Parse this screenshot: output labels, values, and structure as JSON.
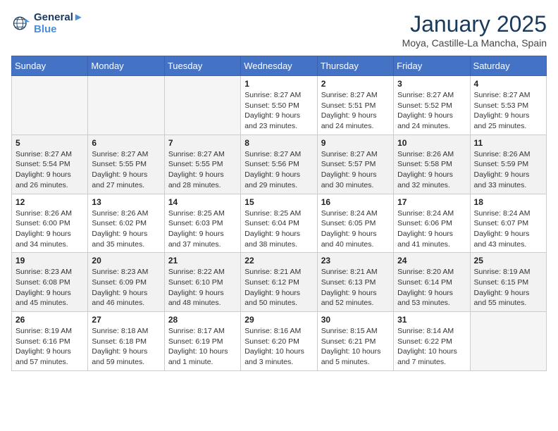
{
  "header": {
    "logo_line1": "General",
    "logo_line2": "Blue",
    "month": "January 2025",
    "location": "Moya, Castille-La Mancha, Spain"
  },
  "days_of_week": [
    "Sunday",
    "Monday",
    "Tuesday",
    "Wednesday",
    "Thursday",
    "Friday",
    "Saturday"
  ],
  "weeks": [
    [
      {
        "day": "",
        "empty": true
      },
      {
        "day": "",
        "empty": true
      },
      {
        "day": "",
        "empty": true
      },
      {
        "day": "1",
        "sunrise": "8:27 AM",
        "sunset": "5:50 PM",
        "daylight": "9 hours and 23 minutes."
      },
      {
        "day": "2",
        "sunrise": "8:27 AM",
        "sunset": "5:51 PM",
        "daylight": "9 hours and 24 minutes."
      },
      {
        "day": "3",
        "sunrise": "8:27 AM",
        "sunset": "5:52 PM",
        "daylight": "9 hours and 24 minutes."
      },
      {
        "day": "4",
        "sunrise": "8:27 AM",
        "sunset": "5:53 PM",
        "daylight": "9 hours and 25 minutes."
      }
    ],
    [
      {
        "day": "5",
        "sunrise": "8:27 AM",
        "sunset": "5:54 PM",
        "daylight": "9 hours and 26 minutes."
      },
      {
        "day": "6",
        "sunrise": "8:27 AM",
        "sunset": "5:55 PM",
        "daylight": "9 hours and 27 minutes."
      },
      {
        "day": "7",
        "sunrise": "8:27 AM",
        "sunset": "5:55 PM",
        "daylight": "9 hours and 28 minutes."
      },
      {
        "day": "8",
        "sunrise": "8:27 AM",
        "sunset": "5:56 PM",
        "daylight": "9 hours and 29 minutes."
      },
      {
        "day": "9",
        "sunrise": "8:27 AM",
        "sunset": "5:57 PM",
        "daylight": "9 hours and 30 minutes."
      },
      {
        "day": "10",
        "sunrise": "8:26 AM",
        "sunset": "5:58 PM",
        "daylight": "9 hours and 32 minutes."
      },
      {
        "day": "11",
        "sunrise": "8:26 AM",
        "sunset": "5:59 PM",
        "daylight": "9 hours and 33 minutes."
      }
    ],
    [
      {
        "day": "12",
        "sunrise": "8:26 AM",
        "sunset": "6:00 PM",
        "daylight": "9 hours and 34 minutes."
      },
      {
        "day": "13",
        "sunrise": "8:26 AM",
        "sunset": "6:02 PM",
        "daylight": "9 hours and 35 minutes."
      },
      {
        "day": "14",
        "sunrise": "8:25 AM",
        "sunset": "6:03 PM",
        "daylight": "9 hours and 37 minutes."
      },
      {
        "day": "15",
        "sunrise": "8:25 AM",
        "sunset": "6:04 PM",
        "daylight": "9 hours and 38 minutes."
      },
      {
        "day": "16",
        "sunrise": "8:24 AM",
        "sunset": "6:05 PM",
        "daylight": "9 hours and 40 minutes."
      },
      {
        "day": "17",
        "sunrise": "8:24 AM",
        "sunset": "6:06 PM",
        "daylight": "9 hours and 41 minutes."
      },
      {
        "day": "18",
        "sunrise": "8:24 AM",
        "sunset": "6:07 PM",
        "daylight": "9 hours and 43 minutes."
      }
    ],
    [
      {
        "day": "19",
        "sunrise": "8:23 AM",
        "sunset": "6:08 PM",
        "daylight": "9 hours and 45 minutes."
      },
      {
        "day": "20",
        "sunrise": "8:23 AM",
        "sunset": "6:09 PM",
        "daylight": "9 hours and 46 minutes."
      },
      {
        "day": "21",
        "sunrise": "8:22 AM",
        "sunset": "6:10 PM",
        "daylight": "9 hours and 48 minutes."
      },
      {
        "day": "22",
        "sunrise": "8:21 AM",
        "sunset": "6:12 PM",
        "daylight": "9 hours and 50 minutes."
      },
      {
        "day": "23",
        "sunrise": "8:21 AM",
        "sunset": "6:13 PM",
        "daylight": "9 hours and 52 minutes."
      },
      {
        "day": "24",
        "sunrise": "8:20 AM",
        "sunset": "6:14 PM",
        "daylight": "9 hours and 53 minutes."
      },
      {
        "day": "25",
        "sunrise": "8:19 AM",
        "sunset": "6:15 PM",
        "daylight": "9 hours and 55 minutes."
      }
    ],
    [
      {
        "day": "26",
        "sunrise": "8:19 AM",
        "sunset": "6:16 PM",
        "daylight": "9 hours and 57 minutes."
      },
      {
        "day": "27",
        "sunrise": "8:18 AM",
        "sunset": "6:18 PM",
        "daylight": "9 hours and 59 minutes."
      },
      {
        "day": "28",
        "sunrise": "8:17 AM",
        "sunset": "6:19 PM",
        "daylight": "10 hours and 1 minute."
      },
      {
        "day": "29",
        "sunrise": "8:16 AM",
        "sunset": "6:20 PM",
        "daylight": "10 hours and 3 minutes."
      },
      {
        "day": "30",
        "sunrise": "8:15 AM",
        "sunset": "6:21 PM",
        "daylight": "10 hours and 5 minutes."
      },
      {
        "day": "31",
        "sunrise": "8:14 AM",
        "sunset": "6:22 PM",
        "daylight": "10 hours and 7 minutes."
      },
      {
        "day": "",
        "empty": true
      }
    ]
  ]
}
